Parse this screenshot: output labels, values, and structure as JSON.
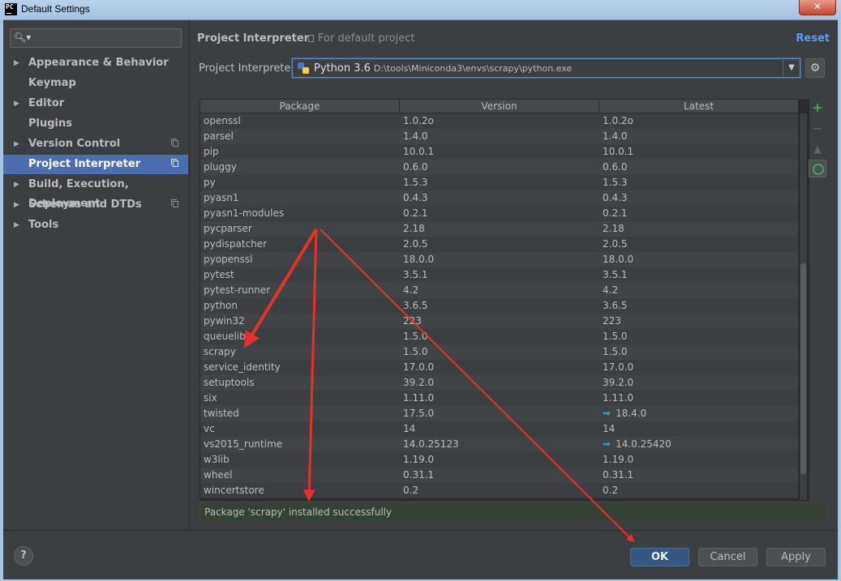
{
  "window": {
    "title": "Default Settings",
    "app_icon_text": "PC",
    "close_glyph": "✕"
  },
  "sidebar": {
    "search_placeholder": "",
    "items": [
      {
        "label": "Appearance & Behavior",
        "expandable": true,
        "selected": false,
        "copy_icon": false
      },
      {
        "label": "Keymap",
        "expandable": false,
        "selected": false,
        "copy_icon": false
      },
      {
        "label": "Editor",
        "expandable": true,
        "selected": false,
        "copy_icon": false
      },
      {
        "label": "Plugins",
        "expandable": false,
        "selected": false,
        "copy_icon": false
      },
      {
        "label": "Version Control",
        "expandable": true,
        "selected": false,
        "copy_icon": true
      },
      {
        "label": "Project Interpreter",
        "expandable": false,
        "selected": true,
        "copy_icon": true
      },
      {
        "label": "Build, Execution, Deployment",
        "expandable": true,
        "selected": false,
        "copy_icon": false
      },
      {
        "label": "Schemas and DTDs",
        "expandable": true,
        "selected": false,
        "copy_icon": true
      },
      {
        "label": "Tools",
        "expandable": true,
        "selected": false,
        "copy_icon": false
      }
    ]
  },
  "header": {
    "title": "Project Interpreter",
    "scope": "For default project",
    "reset": "Reset"
  },
  "interpreter": {
    "label": "Project Interpreter:",
    "name": "Python 3.6",
    "path": "D:\\tools\\Miniconda3\\envs\\scrapy\\python.exe"
  },
  "table": {
    "columns": [
      "Package",
      "Version",
      "Latest"
    ],
    "rows": [
      {
        "package": "openssl",
        "version": "1.0.2o",
        "latest": "1.0.2o",
        "upgrade": false
      },
      {
        "package": "parsel",
        "version": "1.4.0",
        "latest": "1.4.0",
        "upgrade": false
      },
      {
        "package": "pip",
        "version": "10.0.1",
        "latest": "10.0.1",
        "upgrade": false
      },
      {
        "package": "pluggy",
        "version": "0.6.0",
        "latest": "0.6.0",
        "upgrade": false
      },
      {
        "package": "py",
        "version": "1.5.3",
        "latest": "1.5.3",
        "upgrade": false
      },
      {
        "package": "pyasn1",
        "version": "0.4.3",
        "latest": "0.4.3",
        "upgrade": false
      },
      {
        "package": "pyasn1-modules",
        "version": "0.2.1",
        "latest": "0.2.1",
        "upgrade": false
      },
      {
        "package": "pycparser",
        "version": "2.18",
        "latest": "2.18",
        "upgrade": false
      },
      {
        "package": "pydispatcher",
        "version": "2.0.5",
        "latest": "2.0.5",
        "upgrade": false
      },
      {
        "package": "pyopenssl",
        "version": "18.0.0",
        "latest": "18.0.0",
        "upgrade": false
      },
      {
        "package": "pytest",
        "version": "3.5.1",
        "latest": "3.5.1",
        "upgrade": false
      },
      {
        "package": "pytest-runner",
        "version": "4.2",
        "latest": "4.2",
        "upgrade": false
      },
      {
        "package": "python",
        "version": "3.6.5",
        "latest": "3.6.5",
        "upgrade": false
      },
      {
        "package": "pywin32",
        "version": "223",
        "latest": "223",
        "upgrade": false
      },
      {
        "package": "queuelib",
        "version": "1.5.0",
        "latest": "1.5.0",
        "upgrade": false
      },
      {
        "package": "scrapy",
        "version": "1.5.0",
        "latest": "1.5.0",
        "upgrade": false
      },
      {
        "package": "service_identity",
        "version": "17.0.0",
        "latest": "17.0.0",
        "upgrade": false
      },
      {
        "package": "setuptools",
        "version": "39.2.0",
        "latest": "39.2.0",
        "upgrade": false
      },
      {
        "package": "six",
        "version": "1.11.0",
        "latest": "1.11.0",
        "upgrade": false
      },
      {
        "package": "twisted",
        "version": "17.5.0",
        "latest": "18.4.0",
        "upgrade": true
      },
      {
        "package": "vc",
        "version": "14",
        "latest": "14",
        "upgrade": false
      },
      {
        "package": "vs2015_runtime",
        "version": "14.0.25123",
        "latest": "14.0.25420",
        "upgrade": true
      },
      {
        "package": "w3lib",
        "version": "1.19.0",
        "latest": "1.19.0",
        "upgrade": false
      },
      {
        "package": "wheel",
        "version": "0.31.1",
        "latest": "0.31.1",
        "upgrade": false
      },
      {
        "package": "wincertstore",
        "version": "0.2",
        "latest": "0.2",
        "upgrade": false
      }
    ]
  },
  "toolbar": {
    "add": "+",
    "remove": "−",
    "upgrade": "▲"
  },
  "status": {
    "message": "Package 'scrapy' installed successfully"
  },
  "buttons": {
    "help": "?",
    "ok": "OK",
    "cancel": "Cancel",
    "apply": "Apply"
  },
  "colors": {
    "selection": "#4b6eaf",
    "link": "#589df6",
    "add_green": "#3ea553",
    "upgrade_arrow": "#3592c4",
    "annotation_red": "#e8302a"
  }
}
